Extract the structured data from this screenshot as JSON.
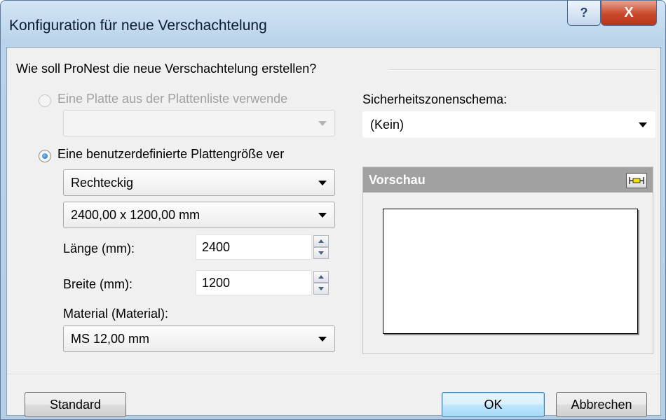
{
  "window": {
    "title": "Konfiguration für neue Verschachtelung",
    "help_label": "?",
    "close_label": "X"
  },
  "dialog": {
    "question": "Wie soll ProNest die neue Verschachtelung erstellen?",
    "option_platelist": {
      "label": "Eine Platte aus der Plattenliste verwende",
      "selected": false,
      "enabled": false,
      "combo_value": ""
    },
    "option_custom": {
      "label": "Eine benutzerdefinierte Plattengröße ver",
      "selected": true,
      "shape_value": "Rechteckig",
      "size_value": "2400,00 x 1200,00 mm"
    },
    "length": {
      "label": "Länge (mm):",
      "value": "2400"
    },
    "width": {
      "label": "Breite (mm):",
      "value": "1200"
    },
    "material": {
      "label": "Material (Material):",
      "value": "MS 12,00 mm"
    },
    "safety_zone": {
      "label": "Sicherheitszonenschema:",
      "value": "(Kein)"
    },
    "preview": {
      "title": "Vorschau"
    }
  },
  "buttons": {
    "standard": "Standard",
    "ok": "OK",
    "cancel": "Abbrechen"
  }
}
